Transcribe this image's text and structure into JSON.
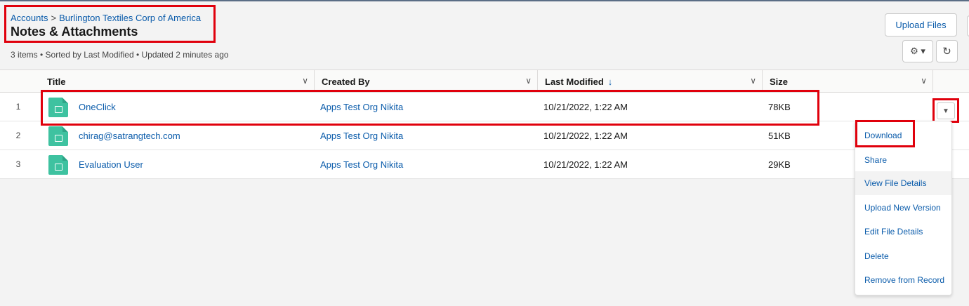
{
  "breadcrumb": {
    "parent": "Accounts",
    "separator": ">",
    "record": "Burlington Textiles Corp of America"
  },
  "page_title": "Notes & Attachments",
  "meta": "3 items • Sorted by Last Modified • Updated 2 minutes ago",
  "toolbar": {
    "upload_label": "Upload Files",
    "gear_label": "⚙ ▾",
    "refresh_label": "↻"
  },
  "columns": [
    {
      "label": "Title"
    },
    {
      "label": "Created By"
    },
    {
      "label": "Last Modified",
      "sort": "↓"
    },
    {
      "label": "Size"
    }
  ],
  "rows": [
    {
      "num": "1",
      "title": "OneClick",
      "created_by": "Apps Test Org Nikita",
      "modified": "10/21/2022, 1:22 AM",
      "size": "78KB"
    },
    {
      "num": "2",
      "title": "chirag@satrangtech.com",
      "created_by": "Apps Test Org Nikita",
      "modified": "10/21/2022, 1:22 AM",
      "size": "51KB"
    },
    {
      "num": "3",
      "title": "Evaluation User",
      "created_by": "Apps Test Org Nikita",
      "modified": "10/21/2022, 1:22 AM",
      "size": "29KB"
    }
  ],
  "row_menu": {
    "items": [
      {
        "label": "Download"
      },
      {
        "label": "Share"
      },
      {
        "label": "View File Details"
      },
      {
        "label": "Upload New Version"
      },
      {
        "label": "Edit File Details"
      },
      {
        "label": "Delete"
      },
      {
        "label": "Remove from Record"
      }
    ]
  },
  "colors": {
    "link": "#0b5cab",
    "highlight": "#e0000c",
    "file_icon": "#3ec2a0"
  }
}
